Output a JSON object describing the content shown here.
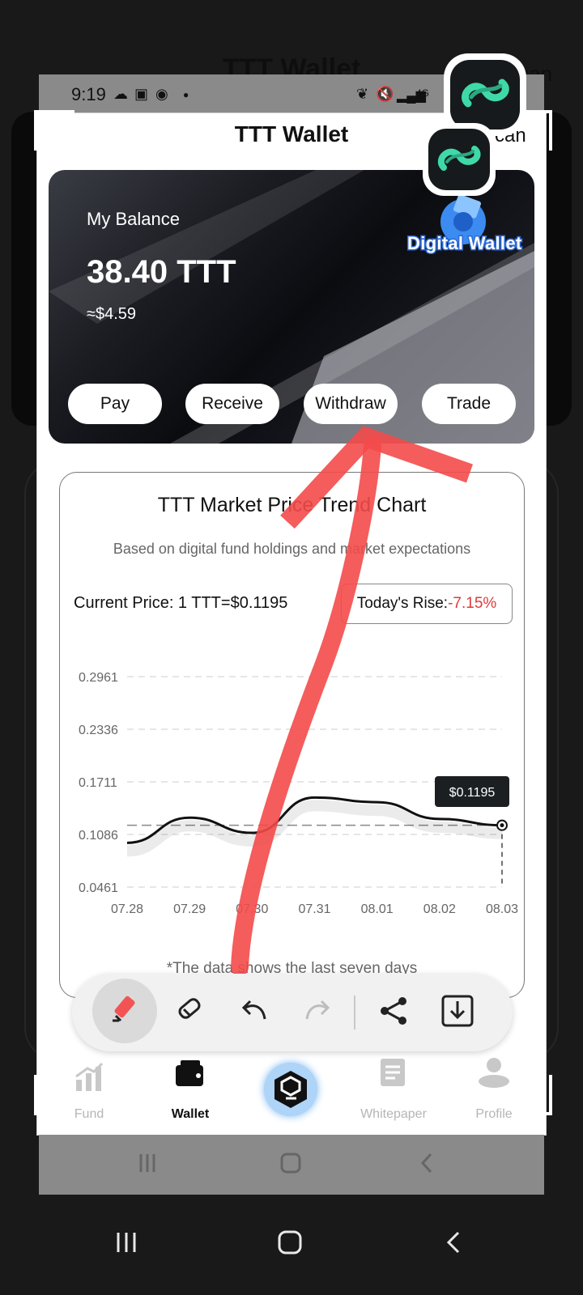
{
  "background": {
    "title": "TTT Wallet",
    "scan": "can"
  },
  "status_bar": {
    "time": "9:19",
    "network": "4G"
  },
  "header": {
    "title": "TTT Wallet",
    "scan_label": "can"
  },
  "balance": {
    "label": "My Balance",
    "amount": "38.40 TTT",
    "usd": "≈$4.59",
    "badge": "Digital Wallet"
  },
  "actions": [
    "Pay",
    "Receive",
    "Withdraw",
    "Trade"
  ],
  "chart_card": {
    "title": "TTT Market Price Trend Chart",
    "subtitle": "Based on digital fund holdings and market expectations",
    "current_price": "Current Price: 1 TTT=$0.1195",
    "rise_label": "Today's Rise:",
    "rise_value": "-7.15%",
    "footnote": "*The data shows the last seven days"
  },
  "chart_data": {
    "type": "line",
    "x": [
      "07.28",
      "07.29",
      "07.30",
      "07.31",
      "08.01",
      "08.02",
      "08.03"
    ],
    "y": [
      0.0986,
      0.1286,
      0.1105,
      0.1525,
      0.147,
      0.127,
      0.1195
    ],
    "yticks": [
      "0.2961",
      "0.2336",
      "0.1711",
      "0.1086",
      "0.0461"
    ],
    "ylim": [
      0.0461,
      0.2961
    ],
    "tooltip": "$0.1195",
    "reference_line": 0.1195,
    "grid": true,
    "title": "",
    "xlabel": "",
    "ylabel": ""
  },
  "toolbar": {
    "tools": [
      "highlighter-icon",
      "eraser-icon",
      "undo-icon",
      "redo-icon",
      "share-icon",
      "download-icon"
    ]
  },
  "nav": {
    "items": [
      {
        "label": "Fund",
        "icon": "chart-bars-icon"
      },
      {
        "label": "Wallet",
        "icon": "wallet-icon"
      },
      {
        "label": "",
        "icon": "center-logo-icon"
      },
      {
        "label": "Whitepaper",
        "icon": "document-icon"
      },
      {
        "label": "Profile",
        "icon": "person-icon"
      }
    ]
  },
  "colors": {
    "accent_red": "#f25454",
    "rise_red": "#e03a3a",
    "card_dark": "#0b0c10",
    "app_icon": "#3fd9a7"
  }
}
